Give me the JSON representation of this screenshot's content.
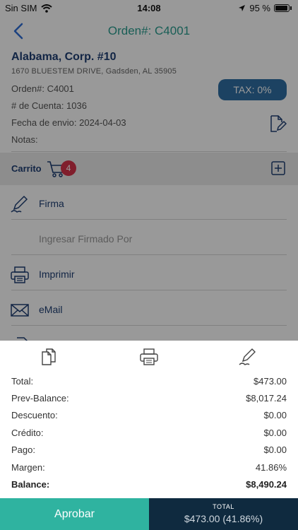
{
  "status": {
    "carrier": "Sin SIM",
    "time": "14:08",
    "battery": "95 %"
  },
  "nav": {
    "title": "Orden#: C4001"
  },
  "order": {
    "company": "Alabama, Corp. #10",
    "address": "1670 BLUESTEM DRIVE, Gadsden, AL 35905",
    "order_number": "Orden#: C4001",
    "account": "# de Cuenta: 1036",
    "ship_date": "Fecha de envio: 2024-04-03",
    "notes": "Notas:",
    "tax": "TAX: 0%"
  },
  "cart": {
    "label": "Carrito",
    "count": "4"
  },
  "menu": {
    "signature": "Firma",
    "signed_by_placeholder": "Ingresar Firmado Por",
    "print": "Imprimir",
    "email": "eMail"
  },
  "summary": [
    {
      "key": "Total:",
      "value": "$473.00"
    },
    {
      "key": "Prev-Balance:",
      "value": "$8,017.24"
    },
    {
      "key": "Descuento:",
      "value": "$0.00"
    },
    {
      "key": "Crédito:",
      "value": "$0.00"
    },
    {
      "key": "Pago:",
      "value": "$0.00"
    },
    {
      "key": "Margen:",
      "value": "41.86%"
    },
    {
      "key": "Balance:",
      "value": "$8,490.24"
    }
  ],
  "footer": {
    "approve": "Aprobar",
    "total_label": "TOTAL",
    "total_value": "$473.00 (41.86%)"
  },
  "colors": {
    "accent": "#2fb3a0",
    "navy": "#0f2a3f",
    "brand_blue": "#1f3f73",
    "badge_red": "#d6334a"
  }
}
